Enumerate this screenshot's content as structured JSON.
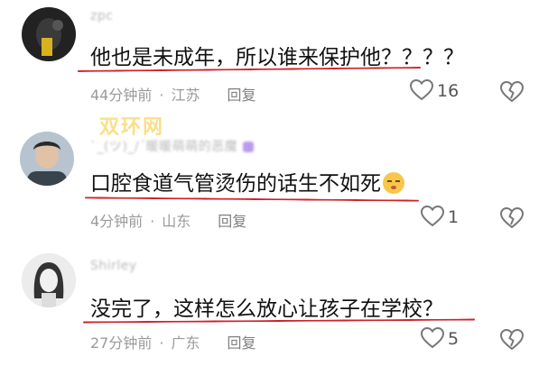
{
  "watermark": "双环网",
  "comments": [
    {
      "username": "zpc",
      "text": "他也是未成年，所以谁来保护他？？？？",
      "time": "44分钟前",
      "location": "江苏",
      "reply_label": "回复",
      "likes": "16",
      "has_emoji": false
    },
    {
      "username": "ˋ_(ツ)_/ˊ暖暖萌萌的恶魔",
      "text": "口腔食道气管烫伤的话生不如死",
      "time": "4分钟前",
      "location": "山东",
      "reply_label": "回复",
      "likes": "1",
      "has_emoji": true
    },
    {
      "username": "Shirley",
      "text": "没完了，这样怎么放心让孩子在学校？",
      "time": "27分钟前",
      "location": "广东",
      "reply_label": "回复",
      "likes": "5",
      "has_emoji": false
    }
  ],
  "colors": {
    "underline": "#d0202a",
    "meta_text": "#9a9a9a",
    "watermark": "#f5c428"
  }
}
